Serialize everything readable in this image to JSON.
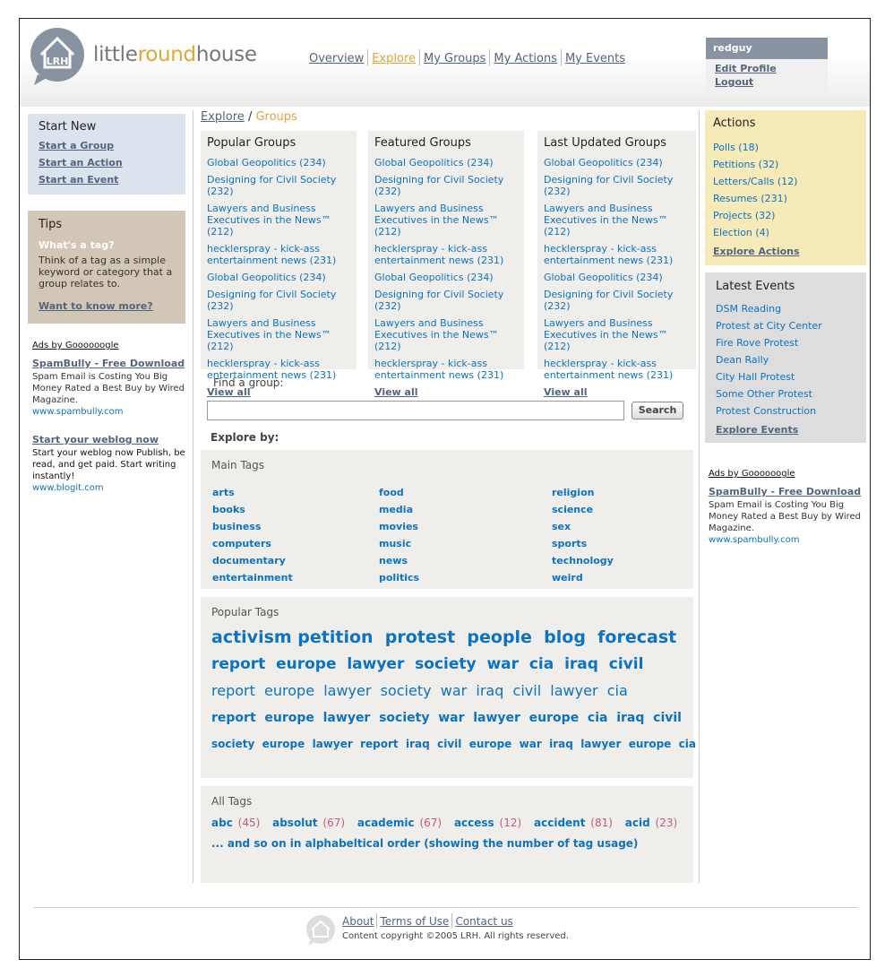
{
  "brand": {
    "logo_mark": "LRH",
    "name_a": "little",
    "name_b": "round",
    "name_c": "house"
  },
  "nav": [
    {
      "label": "Overview"
    },
    {
      "label": "Explore"
    },
    {
      "label": "My Groups"
    },
    {
      "label": "My Actions"
    },
    {
      "label": "My Events"
    }
  ],
  "user": {
    "name": "redguy",
    "edit_profile": "Edit Profile",
    "logout": "Logout"
  },
  "start_new": {
    "title": "Start New",
    "items": [
      "Start a Group",
      "Start an Action",
      "Start an Event"
    ]
  },
  "tips": {
    "title": "Tips",
    "question": "What's a tag?",
    "text": "Think of a tag as a simple keyword or category that a group relates to.",
    "link": "Want to know more?"
  },
  "ads_left": {
    "title": "Ads by Goooooogle",
    "ads": [
      {
        "headline": "SpamBully - Free Download",
        "body": "Spam Email is Costing You Big Money Rated a Best Buy by Wired Magazine.",
        "url": "www.spambully.com"
      },
      {
        "headline": "Start your weblog now",
        "body": "Start your weblog now Publish, be read, and get paid. Start writing instantly!",
        "url": "www.blogit.com"
      }
    ]
  },
  "breadcrumb": {
    "parent": "Explore",
    "sep": "/",
    "current": "Groups"
  },
  "group_lists": [
    {
      "title": "Popular Groups",
      "view_all": "View all",
      "items": [
        "Global Geopolitics (234)",
        "Designing for Civil Society (232)",
        "Lawyers and Business Executives in the News™ (212)",
        "hecklerspray - kick-ass entertainment news (231)",
        "Global Geopolitics (234)",
        "Designing for Civil Society (232)",
        "Lawyers and Business Executives in the News™ (212)",
        "hecklerspray - kick-ass entertainment news (231)"
      ]
    },
    {
      "title": "Featured Groups",
      "view_all": "View all",
      "items": [
        "Global Geopolitics (234)",
        "Designing for Civil Society (232)",
        "Lawyers and Business Executives in the News™ (212)",
        "hecklerspray - kick-ass entertainment news (231)",
        "Global Geopolitics (234)",
        "Designing for Civil Society (232)",
        "Lawyers and Business Executives in the News™ (212)",
        "hecklerspray - kick-ass entertainment news (231)"
      ]
    },
    {
      "title": "Last Updated Groups",
      "view_all": "View all",
      "items": [
        "Global Geopolitics (234)",
        "Designing for Civil Society (232)",
        "Lawyers and Business Executives in the News™ (212)",
        "hecklerspray - kick-ass entertainment news (231)",
        "Global Geopolitics (234)",
        "Designing for Civil Society (232)",
        "Lawyers and Business Executives in the News™ (212)",
        "hecklerspray - kick-ass entertainment news (231)"
      ]
    }
  ],
  "find": {
    "label": "Find a group:",
    "value": "",
    "button": "Search"
  },
  "explore_by": "Explore by:",
  "main_tags": {
    "title": "Main Tags",
    "columns": [
      [
        "arts",
        "books",
        "business",
        "computers",
        "documentary",
        "entertainment"
      ],
      [
        "food",
        "media",
        "movies",
        "music",
        "news",
        "politics"
      ],
      [
        "religion",
        "science",
        "sex",
        "sports",
        "technology",
        "weird"
      ]
    ]
  },
  "popular_tags": {
    "title": "Popular Tags",
    "lines": [
      "activism petition  protest  people  blog  forecast",
      "report  europe  lawyer  society  war  cia  iraq  civil",
      "report  europe  lawyer  society  war  iraq  civil  lawyer  cia",
      "report  europe  lawyer  society  war  lawyer  europe  cia  iraq  civil",
      "society  europe  lawyer  report  iraq  civil  europe  war  iraq  lawyer  europe  cia"
    ]
  },
  "all_tags": {
    "title": "All Tags",
    "items": [
      {
        "tag": "abc",
        "count": "(45)"
      },
      {
        "tag": "absolut",
        "count": "(67)"
      },
      {
        "tag": "academic",
        "count": "(67)"
      },
      {
        "tag": "access",
        "count": "(12)"
      },
      {
        "tag": "accident",
        "count": "(81)"
      },
      {
        "tag": "acid",
        "count": "(23)"
      }
    ],
    "more": "... and so on in alphabeltical order (showing the number of tag usage)"
  },
  "actions": {
    "title": "Actions",
    "items": [
      "Polls (18)",
      "Petitions (32)",
      "Letters/Calls (12)",
      "Resumes (231)",
      "Projects (32)",
      "Election (4)"
    ],
    "explore": "Explore Actions"
  },
  "events": {
    "title": "Latest Events",
    "items": [
      "DSM Reading",
      "Protest at City Center",
      "Fire Rove Protest",
      "Dean Rally",
      "City Hall Protest",
      "Some Other Protest",
      "Protest Construction"
    ],
    "explore": "Explore Events"
  },
  "ads_right": {
    "title": "Ads by Goooooogle",
    "headline": "SpamBully - Free Download",
    "body": "Spam Email is Costing You Big Money Rated a Best Buy by Wired Magazine.",
    "url": "www.spambully.com"
  },
  "footer": {
    "links": [
      "About",
      "Terms of Use",
      "Contact us"
    ],
    "copyright": "Content copyright ©2005 LRH. All rights reserved."
  },
  "colors": {
    "accent": "#e3a43b",
    "link": "#0b73c4",
    "nav": "#52657f"
  }
}
